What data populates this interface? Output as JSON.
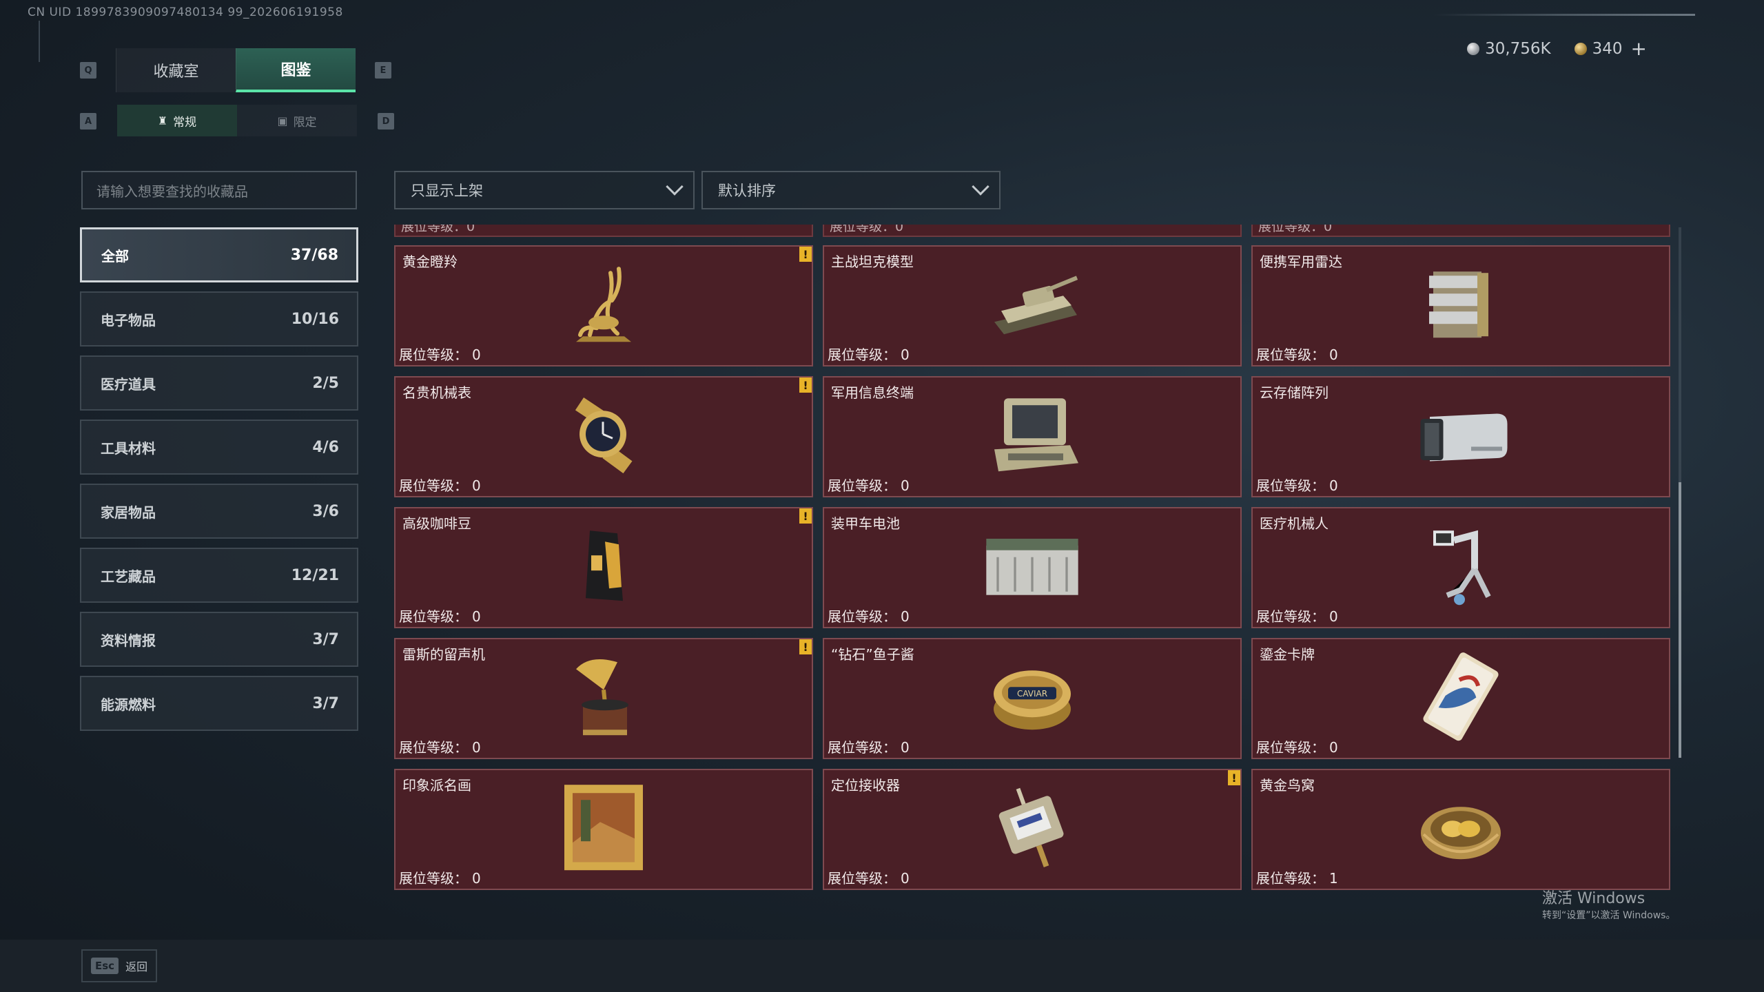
{
  "uid_text": "CN UID 1899783909097480134 99_202606191958",
  "top_tabs": {
    "key_left": "Q",
    "key_right": "E",
    "tabs": [
      "收藏室",
      "图鉴"
    ]
  },
  "sub_tabs": {
    "key_left": "A",
    "key_right": "D",
    "tabs": [
      {
        "label": "常规",
        "icon": "bottle-icon"
      },
      {
        "label": "限定",
        "icon": "image-icon"
      }
    ]
  },
  "currency": {
    "silver": "30,756K",
    "gold": "340",
    "plus": "+"
  },
  "search": {
    "placeholder": "请输入想要查找的收藏品"
  },
  "filters": {
    "shelf": "只显示上架",
    "sort": "默认排序"
  },
  "categories": [
    {
      "label": "全部",
      "count": "37/68"
    },
    {
      "label": "电子物品",
      "count": "10/16"
    },
    {
      "label": "医疗道具",
      "count": "2/5"
    },
    {
      "label": "工具材料",
      "count": "4/6"
    },
    {
      "label": "家居物品",
      "count": "3/6"
    },
    {
      "label": "工艺藏品",
      "count": "12/21"
    },
    {
      "label": "资料情报",
      "count": "3/7"
    },
    {
      "label": "能源燃料",
      "count": "3/7"
    }
  ],
  "level_label": "展位等级：",
  "partial_row_text": "展位等级：0",
  "items": [
    {
      "name": "黄金瞪羚",
      "level": "0",
      "warn": true,
      "icon": "golden-gazelle-icon"
    },
    {
      "name": "主战坦克模型",
      "level": "0",
      "warn": false,
      "icon": "tank-model-icon"
    },
    {
      "name": "便携军用雷达",
      "level": "0",
      "warn": false,
      "icon": "radar-icon"
    },
    {
      "name": "名贵机械表",
      "level": "0",
      "warn": true,
      "icon": "watch-icon"
    },
    {
      "name": "军用信息终端",
      "level": "0",
      "warn": false,
      "icon": "terminal-icon"
    },
    {
      "name": "云存储阵列",
      "level": "0",
      "warn": false,
      "icon": "storage-array-icon"
    },
    {
      "name": "高级咖啡豆",
      "level": "0",
      "warn": true,
      "icon": "coffee-bag-icon"
    },
    {
      "name": "装甲车电池",
      "level": "0",
      "warn": false,
      "icon": "battery-icon"
    },
    {
      "name": "医疗机械人",
      "level": "0",
      "warn": false,
      "icon": "medical-robot-icon"
    },
    {
      "name": "雷斯的留声机",
      "level": "0",
      "warn": true,
      "icon": "gramophone-icon"
    },
    {
      "name": "“钻石”鱼子酱",
      "level": "0",
      "warn": false,
      "icon": "caviar-tin-icon"
    },
    {
      "name": "鎏金卡牌",
      "level": "0",
      "warn": false,
      "icon": "gilded-card-icon"
    },
    {
      "name": "印象派名画",
      "level": "0",
      "warn": false,
      "icon": "painting-icon"
    },
    {
      "name": "定位接收器",
      "level": "0",
      "warn": true,
      "icon": "receiver-icon"
    },
    {
      "name": "黄金鸟窝",
      "level": "1",
      "warn": false,
      "icon": "golden-nest-icon"
    }
  ],
  "caviar_text": "CAVIAR",
  "footer": {
    "esc_key": "Esc",
    "esc_label": "返回"
  },
  "watermark": {
    "line1": "激活 Windows",
    "line2": "转到“设置”以激活 Windows。"
  },
  "colors": {
    "accent": "#5be3a8",
    "card_bg": "#4a1f26",
    "warn": "#e8b328"
  }
}
